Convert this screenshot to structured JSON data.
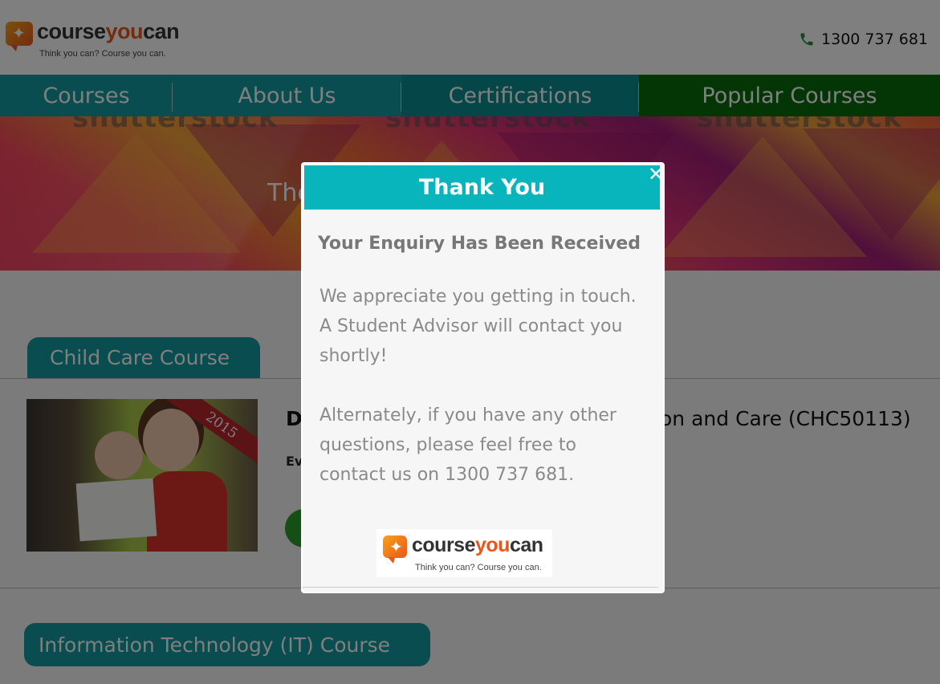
{
  "brand": {
    "name_part1": "course",
    "name_part2": "you",
    "name_part3": "can",
    "tagline": "Think you can? Course you can.",
    "accent_color": "#e8561c"
  },
  "header": {
    "phone_icon": "phone-icon",
    "phone": "1300 737 681"
  },
  "nav": {
    "items": [
      {
        "label": "Courses"
      },
      {
        "label": "About Us"
      },
      {
        "label": "Certifications"
      },
      {
        "label": "Popular Courses"
      }
    ],
    "color": "#129aa1",
    "popular_color": "#086b08"
  },
  "banner": {
    "watermark": "shutterstock",
    "text": "The"
  },
  "courses": [
    {
      "tab_label": "Child Care Course",
      "title_start": "D",
      "title_end": "on and Care (CHC50113)",
      "subtitle_start": "Ev",
      "image_badge": "2015"
    },
    {
      "tab_label": "Information Technology (IT) Course"
    }
  ],
  "modal": {
    "title": "Thank You",
    "close_icon": "close-icon",
    "subtitle": "Your Enquiry Has Been Received",
    "paragraphs": [
      [
        "We appreciate you getting in touch.",
        "A Student Advisor will contact you",
        "shortly!"
      ],
      [
        "Alternately, if you have any other",
        "questions, please feel free to",
        "contact us on 1300 737 681."
      ]
    ],
    "header_color": "#08b5bc"
  }
}
